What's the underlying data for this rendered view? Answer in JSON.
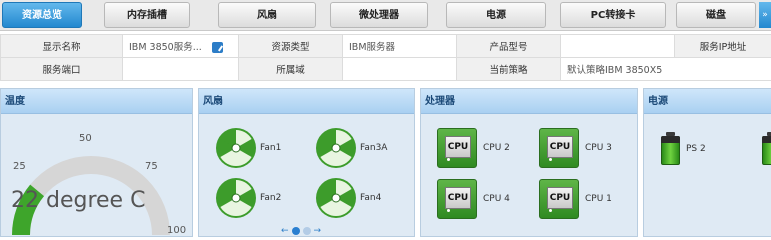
{
  "tabs": [
    {
      "label": "资源总览",
      "active": true
    },
    {
      "label": "内存插槽",
      "active": false
    },
    {
      "label": "风扇",
      "active": false
    },
    {
      "label": "微处理器",
      "active": false
    },
    {
      "label": "电源",
      "active": false
    },
    {
      "label": "PC转接卡",
      "active": false
    },
    {
      "label": "磁盘",
      "active": false
    }
  ],
  "tabs_more_icon": "double-chevron-right-icon",
  "info": {
    "row1": {
      "display_name_label": "显示名称",
      "display_name_value": "IBM 3850服务...",
      "resource_type_label": "资源类型",
      "resource_type_value": "IBM服务器",
      "product_model_label": "产品型号",
      "product_model_value": "",
      "service_ip_label": "服务IP地址",
      "service_ip_value": ""
    },
    "row2": {
      "service_port_label": "服务端口",
      "service_port_value": "",
      "domain_label": "所属域",
      "domain_value": "",
      "current_policy_label": "当前策略",
      "current_policy_value": "默认策略IBM 3850X5"
    }
  },
  "panels": {
    "temperature": {
      "title": "温度",
      "gauge": {
        "min_label": "25",
        "mid_label": "50",
        "high_label": "75",
        "max_label": "100",
        "value": 22,
        "value_text": "22 degree C",
        "scale_min": 0,
        "scale_max": 100
      }
    },
    "fans": {
      "title": "风扇",
      "items": [
        "Fan1",
        "Fan3A",
        "Fan2",
        "Fan4"
      ],
      "pager_prev": "←",
      "pager_next": "→",
      "page_count": 2,
      "current_page": 1
    },
    "cpu": {
      "title": "处理器",
      "chip_text": "CPU",
      "items": [
        "CPU 2",
        "CPU 3",
        "CPU 4",
        "CPU 1"
      ]
    },
    "power": {
      "title": "电源",
      "items": [
        "PS 2"
      ]
    }
  },
  "colors": {
    "tab_active": "#2388cf",
    "panel_bg": "#dfeaf4",
    "panel_header": "#a9d0f1",
    "status_green": "#3b9e2a"
  }
}
